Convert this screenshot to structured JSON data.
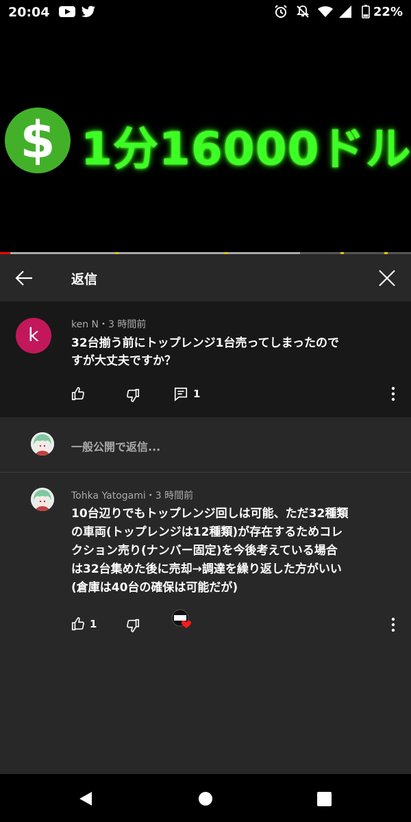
{
  "status_bar": {
    "time": "20:04",
    "battery": "22%",
    "icons": [
      "youtube-icon",
      "twitter-icon",
      "alarm-icon",
      "mute-icon",
      "wifi-icon",
      "signal-icon",
      "battery-icon"
    ]
  },
  "video": {
    "title_text": "1分16000ドル",
    "dollar_symbol": "$",
    "progress_played_fraction": 0.025,
    "progress_buffered_fraction": 0.73,
    "colors": {
      "title": "#3dff25",
      "dollar_circle": "#43b02a",
      "played": "#ff0000",
      "ad_marker": "#e7c400"
    }
  },
  "panel": {
    "title": "返信"
  },
  "main_comment": {
    "avatar_letter": "k",
    "avatar_color": "#c2185b",
    "meta": "ken N・3 時間前",
    "line1": "32台揃う前にトップレンジ1台売ってしまったので",
    "line2": "すが大丈夫ですか？",
    "reply_count": "1"
  },
  "reply_input": {
    "placeholder": "一般公開で返信..."
  },
  "reply_comment": {
    "meta": "Tohka Yatogami・3 時間前",
    "line1": "10台辺りでもトップレンジ回しは可能、ただ32種類",
    "line2": "の車両(トップレンジは12種類)が存在するためコレ",
    "line3": "クション売り(ナンバー固定)を今後考えている場合",
    "line4": "は32台集めた後に売却→調達を繰り返した方がいい",
    "line5": "(倉庫は40台の確保は可能だが)",
    "like_count": "1"
  }
}
